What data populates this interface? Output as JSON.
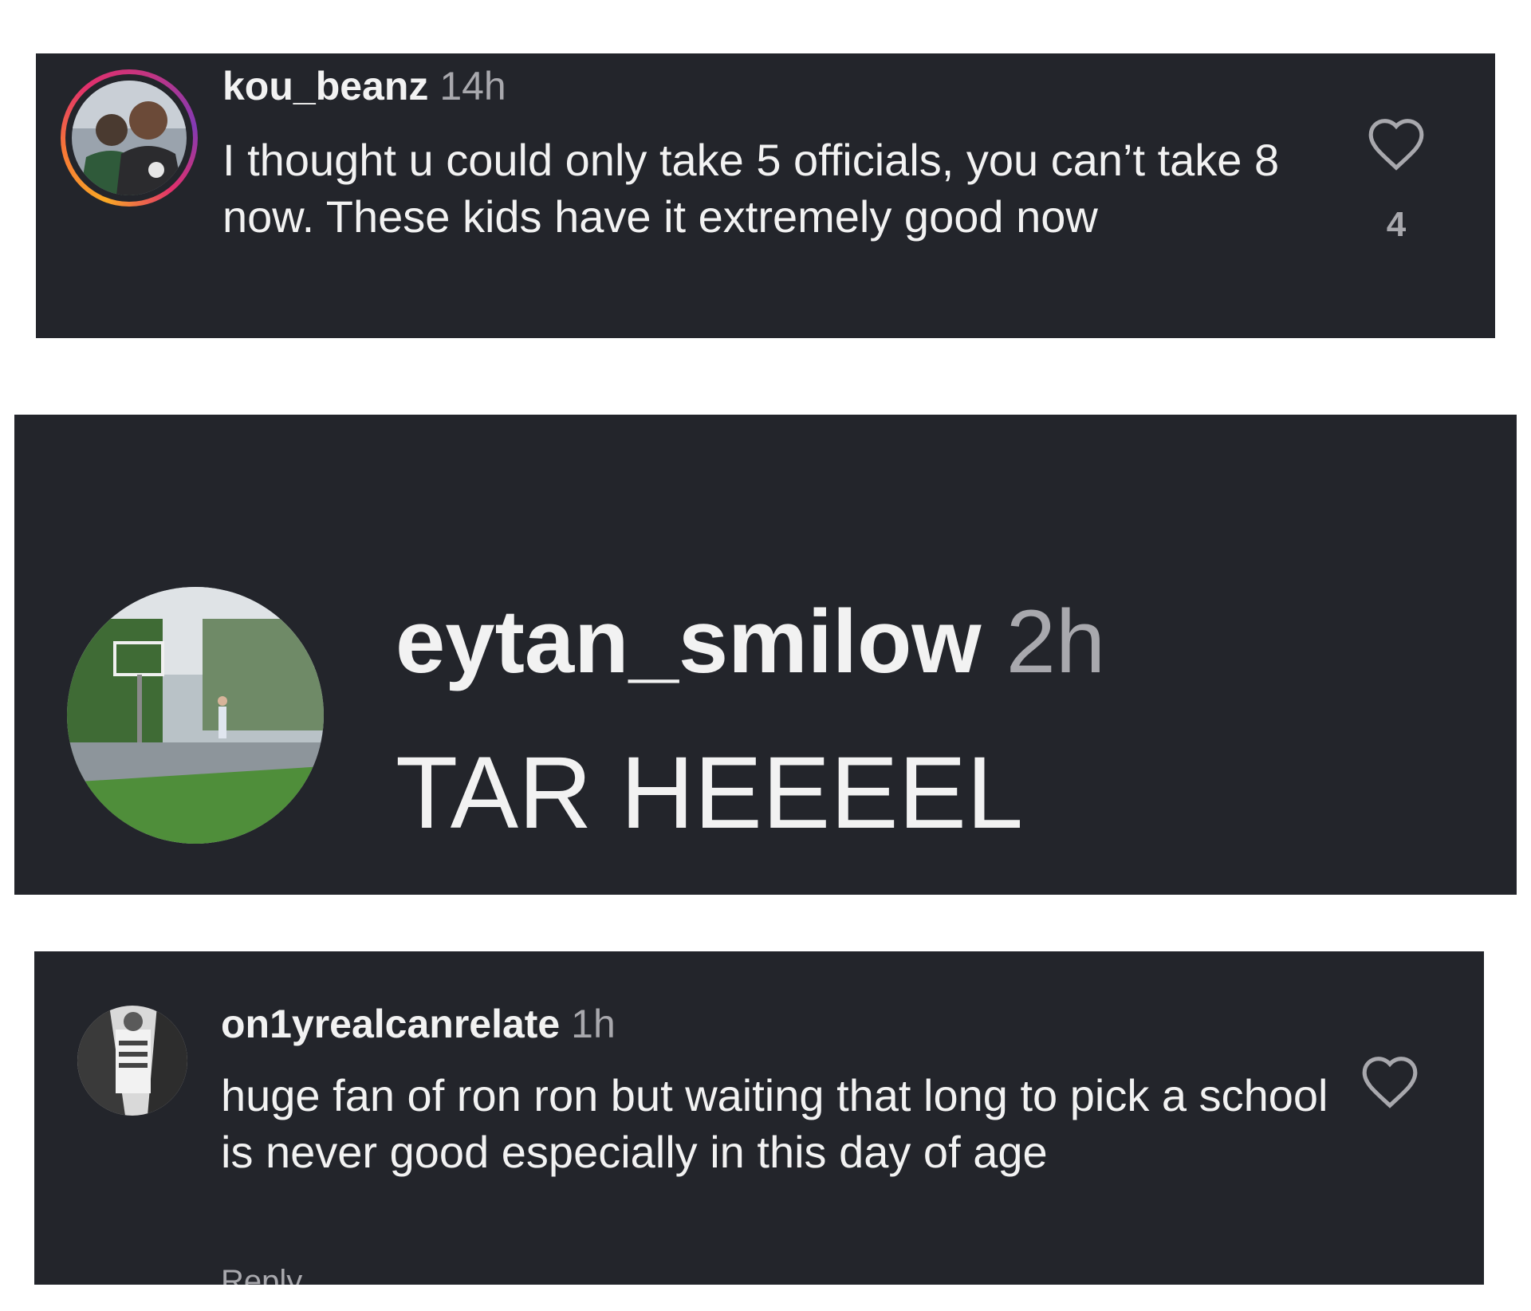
{
  "comments": [
    {
      "username": "kou_beanz",
      "time": "14h",
      "text": "I thought u could only take 5 officials, you can’t take 8 now. These kids have it extremely good now",
      "likes": "4",
      "has_story_ring": true
    },
    {
      "username": "eytan_smilow",
      "time": "2h",
      "text": "TAR HEEEEL"
    },
    {
      "username": "on1yrealcanrelate",
      "time": "1h",
      "text": "huge fan of ron ron but waiting that long to pick a school is never good especially in this day of age",
      "reply_label": "Reply"
    }
  ],
  "colors": {
    "card_bg": "#23252b",
    "text": "#f2f2f2",
    "muted": "#a8a8ad"
  },
  "icons": [
    "heart-icon"
  ]
}
